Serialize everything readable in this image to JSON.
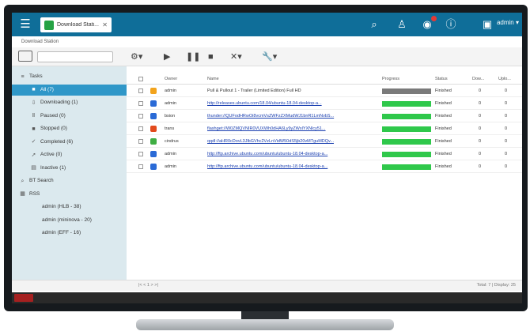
{
  "app": {
    "tab_title": "Download Stati...",
    "breadcrumb": "Download Station",
    "user": "admin"
  },
  "toolbar": {
    "search_placeholder": ""
  },
  "sidebar": {
    "items": [
      {
        "label": "Tasks",
        "icon": "list-icon",
        "indent": 0
      },
      {
        "label": "All (7)",
        "icon": "folder-icon",
        "indent": 1,
        "active": true
      },
      {
        "label": "Downloading (1)",
        "icon": "download-icon",
        "indent": 1
      },
      {
        "label": "Paused (0)",
        "icon": "pause-icon",
        "indent": 1
      },
      {
        "label": "Stopped (0)",
        "icon": "stop-icon",
        "indent": 1
      },
      {
        "label": "Completed (6)",
        "icon": "check-icon",
        "indent": 1
      },
      {
        "label": "Active (0)",
        "icon": "active-icon",
        "indent": 1
      },
      {
        "label": "Inactive (1)",
        "icon": "inactive-icon",
        "indent": 1
      },
      {
        "label": "BT Search",
        "icon": "search-icon",
        "indent": 0
      },
      {
        "label": "RSS",
        "icon": "rss-icon",
        "indent": 0
      },
      {
        "label": "admin (HLB - 38)",
        "icon": "",
        "indent": 2
      },
      {
        "label": "admin (mininova - 20)",
        "icon": "",
        "indent": 2
      },
      {
        "label": "admin (EFF - 16)",
        "icon": "",
        "indent": 2
      }
    ]
  },
  "table": {
    "headers": [
      "Owner",
      "Name",
      "Progress",
      "Status",
      "Dow...",
      "Uplo..."
    ],
    "rows": [
      {
        "owner": "admin",
        "name": "Pull & Pullout 1 - Trailer (Limited Edition) Full HD",
        "progress": 1.0,
        "status": "Finished",
        "down": "0",
        "up": "0",
        "icon_color": "#f2a31c",
        "link": false
      },
      {
        "owner": "admin",
        "name": "http://releases.ubuntu.com/18.04/ubuntu-18.04-desktop-a...",
        "progress": 1.0,
        "status": "Finished",
        "down": "0",
        "up": "0",
        "icon_color": "#2a6ad6",
        "link": true
      },
      {
        "owner": "bsion",
        "name": "thunder://QUFodHRwOi8vcmVsZWFzZXMudWJ1bnR1LmNvbS...",
        "progress": 1.0,
        "status": "Finished",
        "down": "0",
        "up": "0",
        "icon_color": "#2a6ad6",
        "link": true
      },
      {
        "owner": "trans",
        "name": "flashget://W0ZMQVNIR0VUXWh0dHA6Ly9yZWxlYXNlcy51...",
        "progress": 1.0,
        "status": "Finished",
        "down": "0",
        "up": "0",
        "icon_color": "#e24a1c",
        "link": true
      },
      {
        "owner": "cindrus",
        "name": "qqdl://aHR0cDovL3JlbGVhc2VzLnVidW50dS5jb20vMTguMDQv...",
        "progress": 1.0,
        "status": "Finished",
        "down": "0",
        "up": "0",
        "icon_color": "#3fae43",
        "link": true
      },
      {
        "owner": "admin",
        "name": "http://ftp.archive.ubuntu.com/ubuntu/ubuntu-18.04-desktop-a...",
        "progress": 1.0,
        "status": "Finished",
        "down": "0",
        "up": "0",
        "icon_color": "#2a6ad6",
        "link": true
      },
      {
        "owner": "admin",
        "name": "http://ftp.archive.ubuntu.com/ubuntu/ubuntu-18.04-desktop-a...",
        "progress": 1.0,
        "status": "Finished",
        "down": "0",
        "up": "0",
        "icon_color": "#2a6ad6",
        "link": true
      }
    ]
  },
  "footer": {
    "pager": "|< < 1 > >|",
    "summary": "Total: 7 | Display: 25"
  }
}
